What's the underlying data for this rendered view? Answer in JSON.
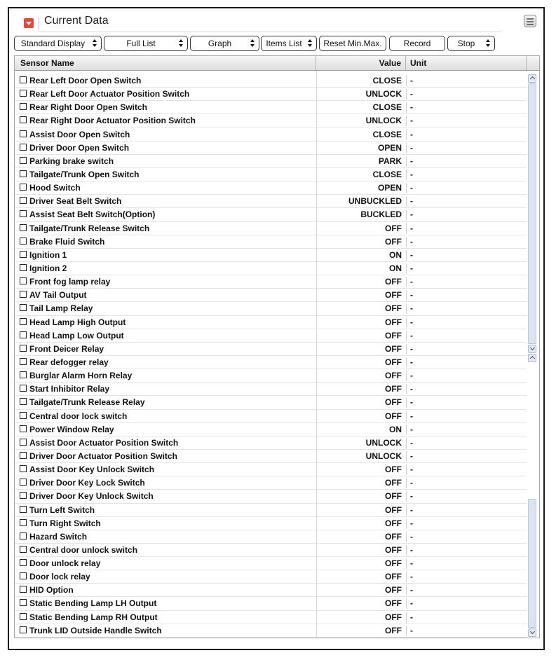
{
  "window": {
    "title": "Current Data"
  },
  "toolbar": {
    "buttons": [
      {
        "label": "Standard Display",
        "dropdown": true
      },
      {
        "label": "Full List",
        "dropdown": true
      },
      {
        "label": "Graph",
        "dropdown": true
      },
      {
        "label": "Items List",
        "dropdown": true
      },
      {
        "label": "Reset Min.Max.",
        "dropdown": false
      },
      {
        "label": "Record",
        "dropdown": false
      },
      {
        "label": "Stop",
        "dropdown": true
      }
    ]
  },
  "table": {
    "columns": {
      "name": "Sensor Name",
      "value": "Value",
      "unit": "Unit"
    },
    "rows": [
      {
        "name": "Rear Left Door Open Switch",
        "value": "CLOSE",
        "unit": "-"
      },
      {
        "name": "Rear Left Door Actuator Position Switch",
        "value": "UNLOCK",
        "unit": "-"
      },
      {
        "name": "Rear Right Door Open Switch",
        "value": "CLOSE",
        "unit": "-"
      },
      {
        "name": "Rear Right Door Actuator Position Switch",
        "value": "UNLOCK",
        "unit": "-"
      },
      {
        "name": "Assist Door Open Switch",
        "value": "CLOSE",
        "unit": "-"
      },
      {
        "name": "Driver Door Open Switch",
        "value": "OPEN",
        "unit": "-"
      },
      {
        "name": "Parking brake switch",
        "value": "PARK",
        "unit": "-"
      },
      {
        "name": "Tailgate/Trunk Open Switch",
        "value": "CLOSE",
        "unit": "-"
      },
      {
        "name": "Hood Switch",
        "value": "OPEN",
        "unit": "-"
      },
      {
        "name": "Driver Seat Belt Switch",
        "value": "UNBUCKLED",
        "unit": "-"
      },
      {
        "name": "Assist Seat Belt Switch(Option)",
        "value": "BUCKLED",
        "unit": "-"
      },
      {
        "name": "Tailgate/Trunk Release Switch",
        "value": "OFF",
        "unit": "-"
      },
      {
        "name": "Brake Fluid Switch",
        "value": "OFF",
        "unit": "-"
      },
      {
        "name": "Ignition 1",
        "value": "ON",
        "unit": "-"
      },
      {
        "name": "Ignition 2",
        "value": "ON",
        "unit": "-"
      },
      {
        "name": "Front fog lamp relay",
        "value": "OFF",
        "unit": "-"
      },
      {
        "name": "AV Tail Output",
        "value": "OFF",
        "unit": "-"
      },
      {
        "name": "Tail Lamp Relay",
        "value": "OFF",
        "unit": "-"
      },
      {
        "name": "Head Lamp High Output",
        "value": "OFF",
        "unit": "-"
      },
      {
        "name": "Head Lamp Low Output",
        "value": "OFF",
        "unit": "-"
      },
      {
        "name": "Front Deicer Relay",
        "value": "OFF",
        "unit": "-"
      },
      {
        "name": "Rear defogger relay",
        "value": "OFF",
        "unit": "-"
      },
      {
        "name": "Burglar Alarm Horn Relay",
        "value": "OFF",
        "unit": "-"
      },
      {
        "name": "Start Inhibitor Relay",
        "value": "OFF",
        "unit": "-"
      },
      {
        "name": "Tailgate/Trunk Release Relay",
        "value": "OFF",
        "unit": "-"
      },
      {
        "name": "Central door lock switch",
        "value": "OFF",
        "unit": "-"
      },
      {
        "name": "Power Window Relay",
        "value": "ON",
        "unit": "-"
      },
      {
        "name": "Assist Door Actuator Position Switch",
        "value": "UNLOCK",
        "unit": "-"
      },
      {
        "name": "Driver Door Actuator Position Switch",
        "value": "UNLOCK",
        "unit": "-"
      },
      {
        "name": "Assist Door Key Unlock Switch",
        "value": "OFF",
        "unit": "-"
      },
      {
        "name": "Driver Door Key Lock Switch",
        "value": "OFF",
        "unit": "-"
      },
      {
        "name": "Driver Door Key Unlock Switch",
        "value": "OFF",
        "unit": "-"
      },
      {
        "name": "Turn Left Switch",
        "value": "OFF",
        "unit": "-"
      },
      {
        "name": "Turn Right Switch",
        "value": "OFF",
        "unit": "-"
      },
      {
        "name": "Hazard Switch",
        "value": "OFF",
        "unit": "-"
      },
      {
        "name": "Central door unlock switch",
        "value": "OFF",
        "unit": "-"
      },
      {
        "name": "Door unlock relay",
        "value": "OFF",
        "unit": "-"
      },
      {
        "name": "Door lock relay",
        "value": "OFF",
        "unit": "-"
      },
      {
        "name": "HID Option",
        "value": "OFF",
        "unit": "-"
      },
      {
        "name": "Static Bending Lamp LH Output",
        "value": "OFF",
        "unit": "-"
      },
      {
        "name": "Static Bending Lamp RH Output",
        "value": "OFF",
        "unit": "-"
      },
      {
        "name": "Trunk LID Outside Handle Switch",
        "value": "OFF",
        "unit": "-"
      }
    ]
  },
  "icons": {
    "collapse": "collapse-down-icon",
    "window_menu": "window-menu-icon",
    "dropdown": "updown-arrows-icon",
    "checkbox": "checkbox-icon"
  },
  "colors": {
    "accent": "#e8453c",
    "scroll_thumb": "#dbe4f5"
  }
}
